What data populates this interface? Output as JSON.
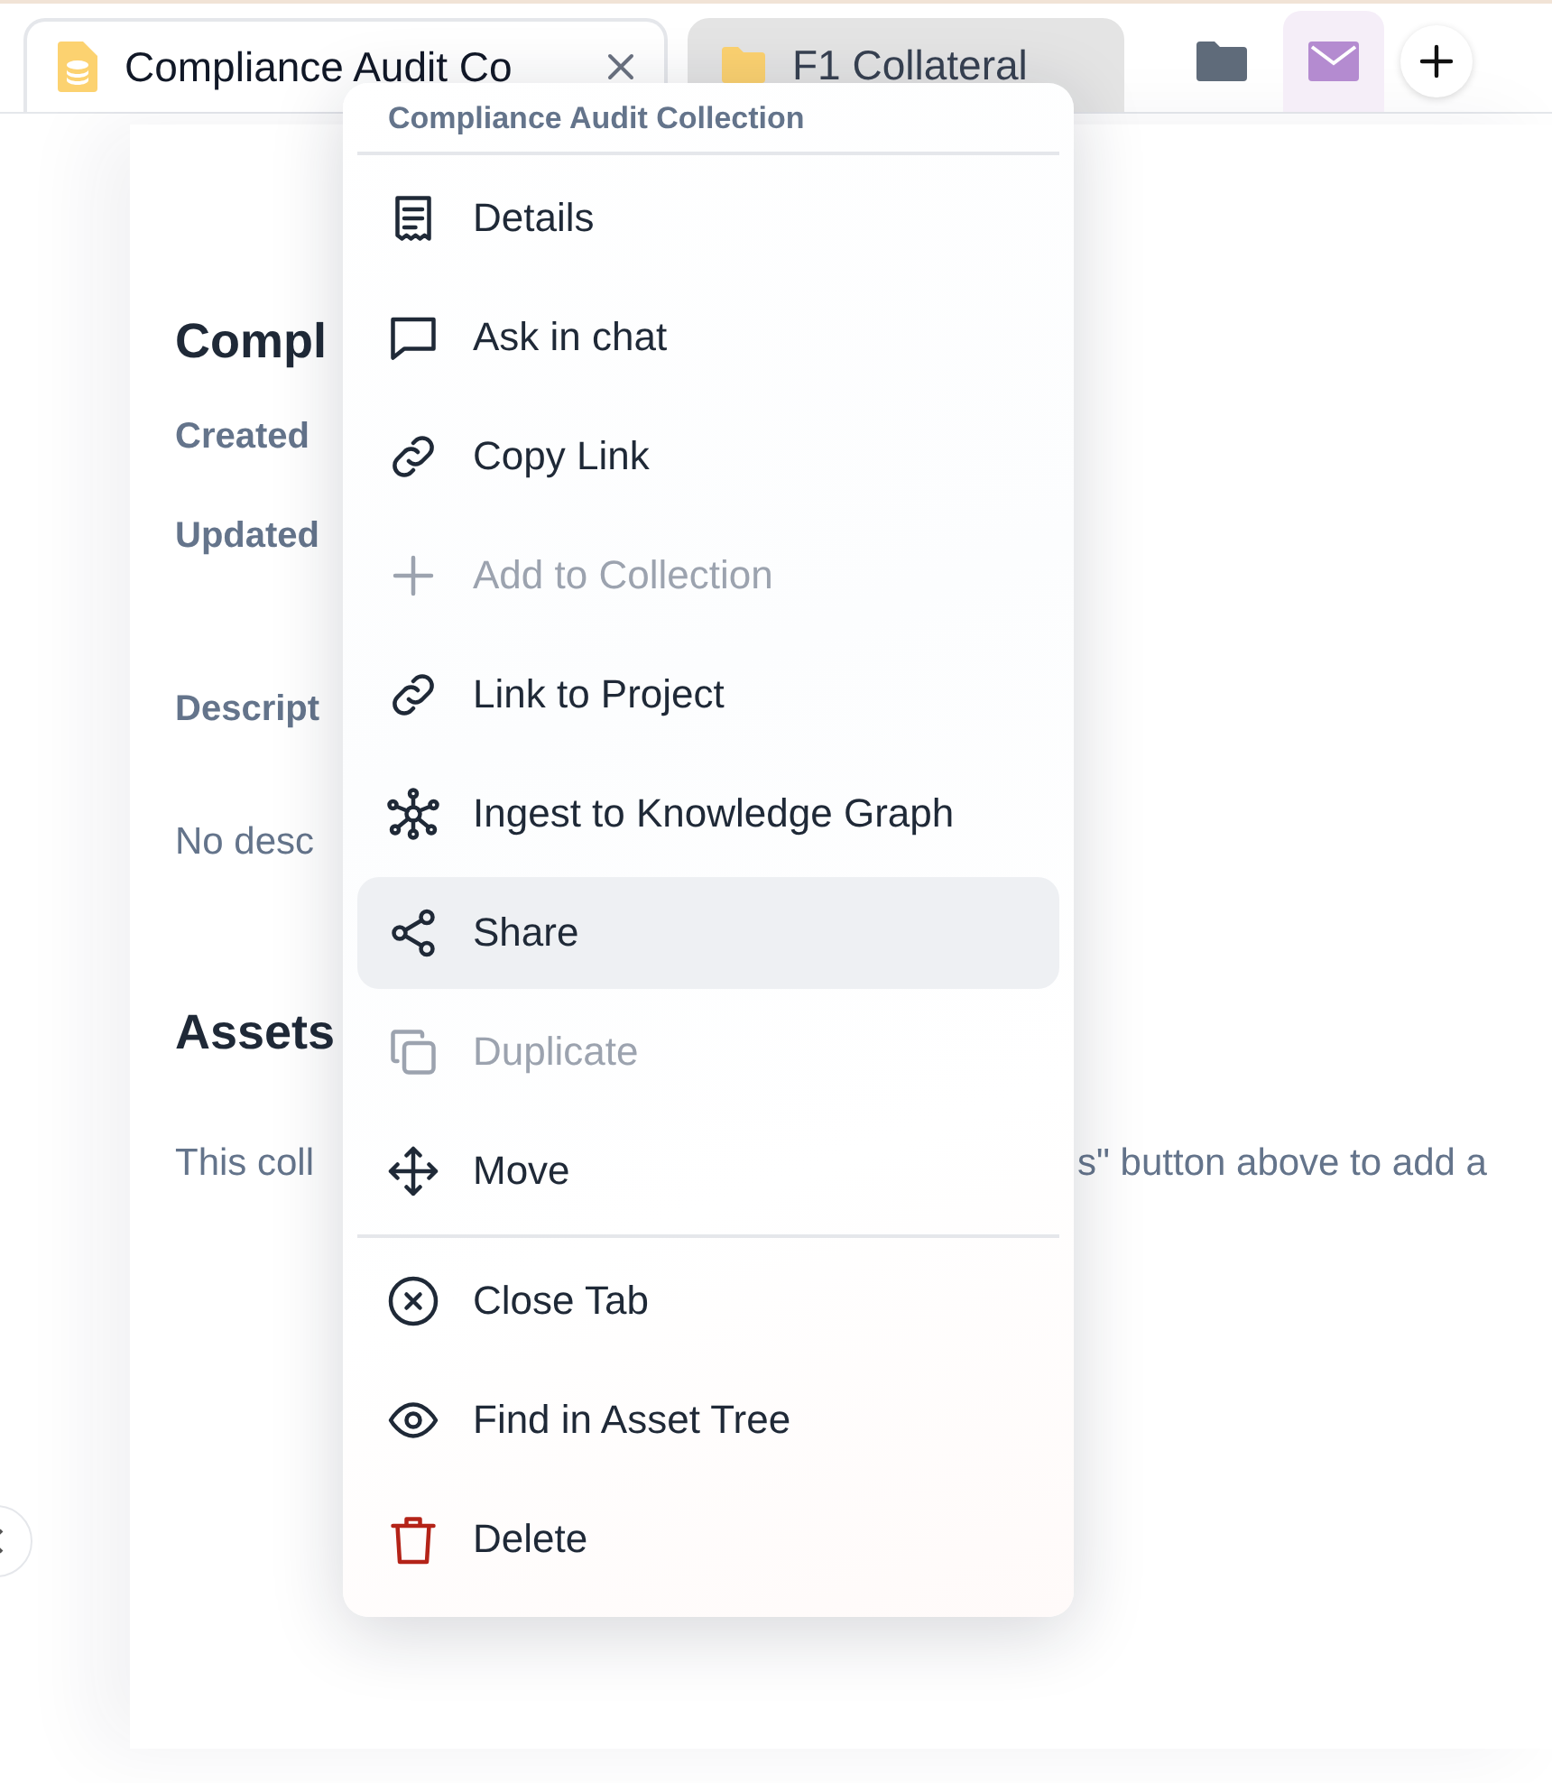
{
  "tabs": [
    {
      "label": "Compliance Audit Co",
      "selected": true,
      "kind": "collection"
    },
    {
      "label": "F1 Collateral",
      "selected": false,
      "kind": "folder"
    }
  ],
  "page": {
    "title": "Compl",
    "created_label": "Created",
    "updated_label": "Updated",
    "description_label": "Descript",
    "description_text": "No desc",
    "assets_heading": "Assets",
    "assets_text_left": "This coll",
    "assets_text_right": "s\" button above to add a"
  },
  "context_menu": {
    "header": "Compliance Audit Collection",
    "groups": [
      [
        {
          "label": "Details",
          "disabled": false,
          "selected": false,
          "danger": false
        },
        {
          "label": "Ask in chat",
          "disabled": false,
          "selected": false,
          "danger": false
        },
        {
          "label": "Copy Link",
          "disabled": false,
          "selected": false,
          "danger": false
        },
        {
          "label": "Add to Collection",
          "disabled": true,
          "selected": false,
          "danger": false
        },
        {
          "label": "Link to Project",
          "disabled": false,
          "selected": false,
          "danger": false
        },
        {
          "label": "Ingest to Knowledge Graph",
          "disabled": false,
          "selected": false,
          "danger": false
        },
        {
          "label": "Share",
          "disabled": false,
          "selected": true,
          "danger": false
        },
        {
          "label": "Duplicate",
          "disabled": true,
          "selected": false,
          "danger": false
        },
        {
          "label": "Move",
          "disabled": false,
          "selected": false,
          "danger": false
        }
      ],
      [
        {
          "label": "Close Tab",
          "disabled": false,
          "selected": false,
          "danger": false
        },
        {
          "label": "Find in Asset Tree",
          "disabled": false,
          "selected": false,
          "danger": false
        },
        {
          "label": "Delete",
          "disabled": false,
          "selected": false,
          "danger": true
        }
      ]
    ]
  }
}
